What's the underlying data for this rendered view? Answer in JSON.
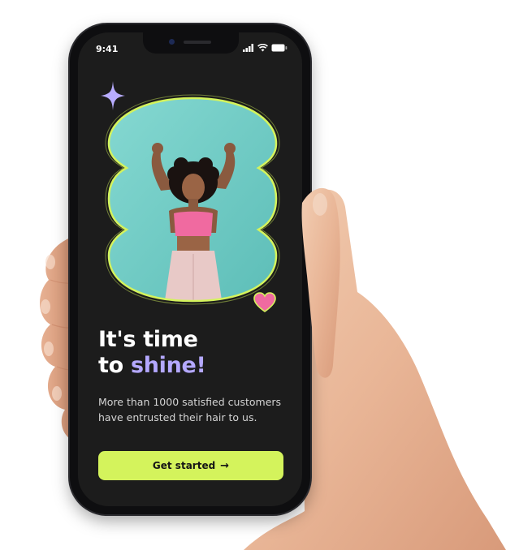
{
  "status_bar": {
    "time": "9:41"
  },
  "hero": {
    "headline_line1": "It's time",
    "headline_to": "to",
    "headline_accent": "shine!",
    "subtitle": "More than 1000 satisfied customers have entrusted their hair to us."
  },
  "cta": {
    "label": "Get started",
    "arrow": "→"
  },
  "icons": {
    "sparkle": "sparkle-icon",
    "heart": "heart-icon",
    "signal": "signal-icon",
    "wifi": "wifi-icon",
    "battery": "battery-icon",
    "arrow": "arrow-right-icon"
  },
  "colors": {
    "screen_bg": "#1c1c1c",
    "accent_lime": "#d4f35c",
    "accent_lavender": "#b4a8ff",
    "heart_pink": "#f06aa0",
    "photo_bg": "#7fd3cc",
    "text_white": "#ffffff"
  }
}
